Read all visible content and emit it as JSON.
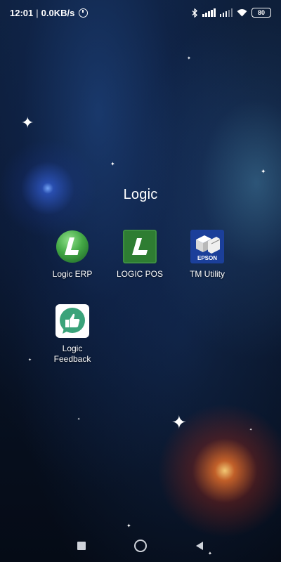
{
  "status_bar": {
    "time": "12:01",
    "separator": "|",
    "net_speed": "0.0KB/s",
    "battery_level": "80"
  },
  "folder": {
    "title": "Logic"
  },
  "apps": [
    {
      "label": "Logic ERP",
      "icon": "logic-erp-icon"
    },
    {
      "label": "LOGIC POS",
      "icon": "logic-pos-icon"
    },
    {
      "label": "TM Utility",
      "icon": "epson-tm-utility-icon",
      "brand_text": "EPSON"
    },
    {
      "label": "Logic Feedback",
      "icon": "logic-feedback-icon"
    }
  ],
  "navbar": {
    "recents": "recents-square-icon",
    "home": "home-circle-icon",
    "back": "back-triangle-icon"
  },
  "colors": {
    "erp_green": "#4caf50",
    "pos_green": "#2e7d32",
    "epson_blue": "#1b3f9a",
    "feedback_teal": "#3aa37a"
  }
}
